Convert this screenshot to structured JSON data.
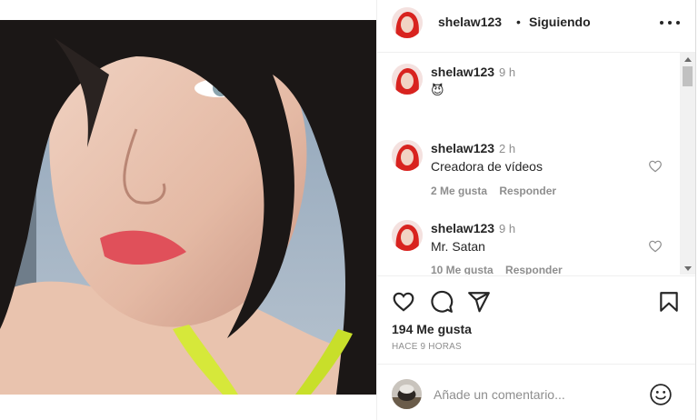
{
  "header": {
    "username": "shelaw123",
    "separator": "•",
    "follow_status": "Siguiendo"
  },
  "comments": [
    {
      "username": "shelaw123",
      "time": "9 h",
      "text": "😈",
      "likes": "",
      "reply": ""
    },
    {
      "username": "shelaw123",
      "time": "2 h",
      "text": "Creadora de vídeos",
      "likes": "2 Me gusta",
      "reply": "Responder"
    },
    {
      "username": "shelaw123",
      "time": "9 h",
      "text": "Mr. Satan",
      "likes": "10 Me gusta",
      "reply": "Responder"
    }
  ],
  "actions": {
    "likes_count": "194 Me gusta",
    "post_time": "HACE 9 HORAS"
  },
  "comment_box": {
    "placeholder": "Añade un comentario..."
  },
  "icons": {
    "like": "heart-icon",
    "comment": "comment-icon",
    "share": "paper-plane-icon",
    "save": "bookmark-icon",
    "emoji": "smiley-icon",
    "more": "more-options-icon"
  },
  "colors": {
    "text": "#262626",
    "secondary": "#8e8e8e",
    "border": "#efefef"
  }
}
